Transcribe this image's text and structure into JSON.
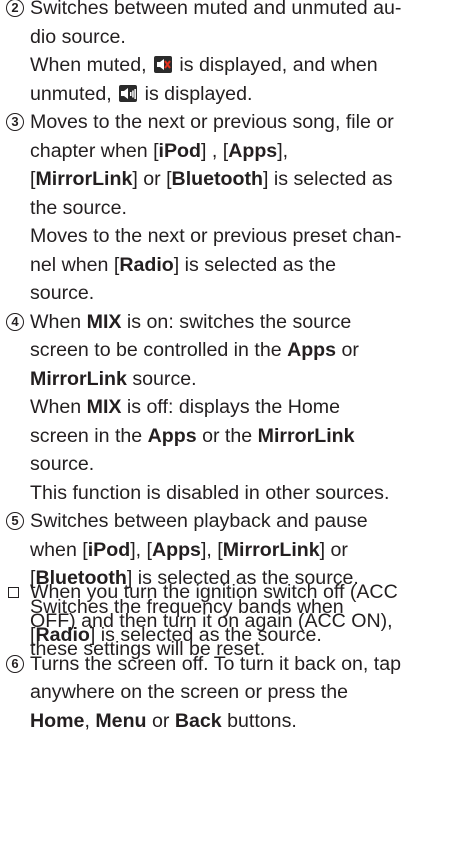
{
  "items": [
    {
      "num": "2",
      "lines": [
        [
          "Switches between muted and unmuted au-"
        ],
        [
          "dio source."
        ],
        [
          "When muted, ",
          {
            "icon": "muted-speaker-icon"
          },
          " is displayed, and when"
        ],
        [
          "unmuted, ",
          {
            "icon": "unmuted-speaker-icon"
          },
          " is displayed."
        ]
      ]
    },
    {
      "num": "3",
      "lines": [
        [
          "Moves to the next or previous song, file or"
        ],
        [
          "chapter when [",
          {
            "b": "iPod"
          },
          "] , [",
          {
            "b": "Apps"
          },
          "],"
        ],
        [
          "[",
          {
            "b": "MirrorLink"
          },
          "] or [",
          {
            "b": "Bluetooth"
          },
          "] is selected as"
        ],
        [
          "the source."
        ],
        [
          "Moves to the next or previous preset chan-"
        ],
        [
          "nel when [",
          {
            "b": "Radio"
          },
          "] is selected as the"
        ],
        [
          "source."
        ]
      ]
    },
    {
      "num": "4",
      "lines": [
        [
          "When ",
          {
            "b": "MIX"
          },
          " is on: switches the source"
        ],
        [
          "screen to be controlled in the ",
          {
            "b": "Apps"
          },
          " or"
        ],
        [
          {
            "b": "MirrorLink"
          },
          " source."
        ],
        [
          "When ",
          {
            "b": "MIX"
          },
          " is off: displays the Home"
        ],
        [
          "screen in the ",
          {
            "b": "Apps"
          },
          " or the ",
          {
            "b": "MirrorLink"
          }
        ],
        [
          "source."
        ],
        [
          "This function is disabled in other sources."
        ]
      ]
    },
    {
      "num": "5",
      "lines": [
        [
          "Switches between playback and pause"
        ],
        [
          "when [",
          {
            "b": "iPod"
          },
          "], [",
          {
            "b": "Apps"
          },
          "], [",
          {
            "b": "MirrorLink"
          },
          "] or"
        ],
        [
          "[",
          {
            "b": "Bluetooth"
          },
          "] is selected as the source."
        ],
        [
          "Switches the frequency bands when"
        ],
        [
          "[",
          {
            "b": "Radio"
          },
          "] is selected as the source."
        ]
      ]
    },
    {
      "num": "6",
      "lines": [
        [
          "Turns the screen off. To turn it back on, tap"
        ],
        [
          "anywhere on the screen or press the"
        ],
        [
          {
            "b": "Home"
          },
          ", ",
          {
            "b": "Menu"
          },
          " or ",
          {
            "b": "Back"
          },
          " buttons."
        ]
      ]
    }
  ],
  "note": {
    "lines": [
      [
        "When you turn the ignition switch off (ACC"
      ],
      [
        "OFF) and then turn it on again (ACC ON),"
      ],
      [
        "these settings will be reset."
      ]
    ]
  }
}
